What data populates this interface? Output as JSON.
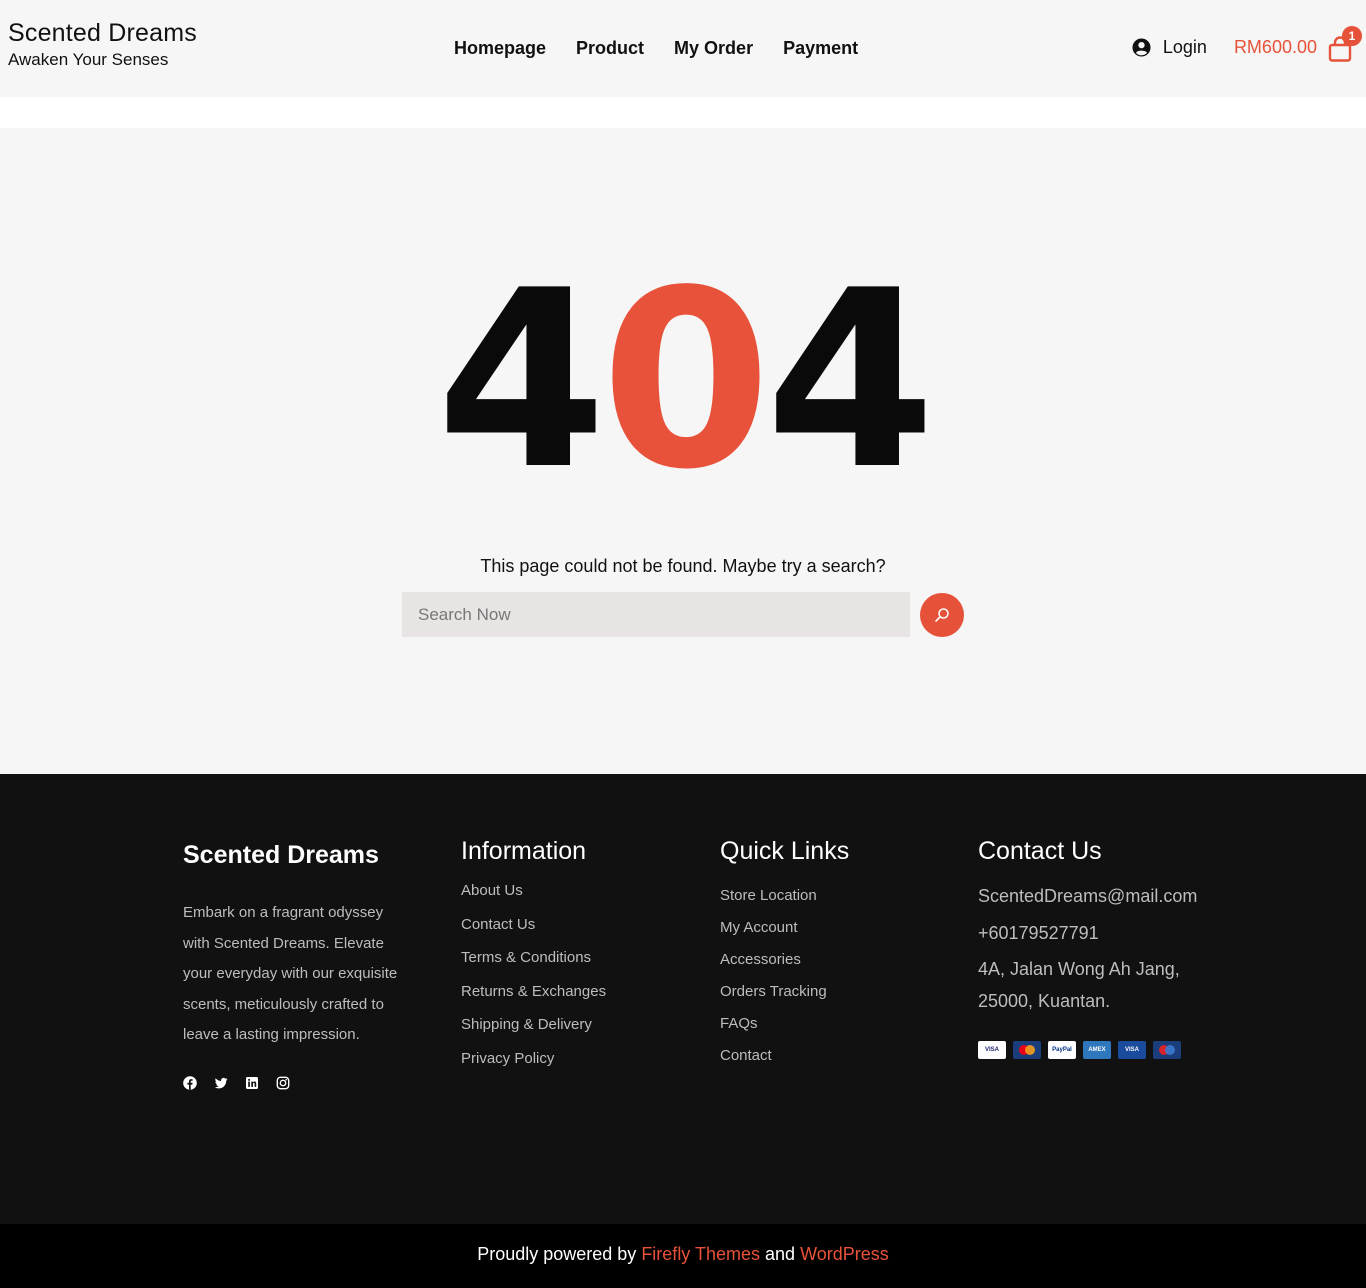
{
  "header": {
    "brand_title": "Scented Dreams",
    "brand_tagline": "Awaken Your Senses",
    "nav": [
      "Homepage",
      "Product",
      "My Order",
      "Payment"
    ],
    "login_label": "Login",
    "cart_total": "RM600.00",
    "cart_count": "1",
    "icons": {
      "login": "user-circle-icon",
      "cart": "shopping-bag-icon"
    }
  },
  "main": {
    "error_code": [
      "4",
      "0",
      "4"
    ],
    "message": "This page could not be found. Maybe try a search?",
    "search_placeholder": "Search Now",
    "search_icon": "search-icon"
  },
  "footer": {
    "brand": {
      "title": "Scented Dreams",
      "description": "Embark on a fragrant odyssey with Scented Dreams. Elevate your everyday with our exquisite scents, meticulously crafted to leave a lasting impression.",
      "socials": [
        "facebook-icon",
        "twitter-icon",
        "linkedin-icon",
        "instagram-icon"
      ]
    },
    "information": {
      "title": "Information",
      "links": [
        "About Us",
        "Contact Us",
        "Terms & Conditions",
        "Returns & Exchanges",
        "Shipping & Delivery",
        "Privacy Policy"
      ]
    },
    "quick_links": {
      "title": "Quick Links",
      "links": [
        "Store Location",
        "My Account",
        "Accessories",
        "Orders Tracking",
        "FAQs",
        "Contact"
      ]
    },
    "contact": {
      "title": "Contact Us",
      "email": "ScentedDreams@mail.com",
      "phone": "+60179527791",
      "address": "4A, Jalan Wong Ah Jang, 25000, Kuantan.",
      "cards": [
        {
          "name": "visa",
          "label": "VISA",
          "bg": "#ffffff",
          "fg": "#1a1f71"
        },
        {
          "name": "mastercard",
          "label": "",
          "bg": "#1a3d7c",
          "fg": "#ffffff"
        },
        {
          "name": "paypal",
          "label": "PayPal",
          "bg": "#ffffff",
          "fg": "#003087"
        },
        {
          "name": "amex",
          "label": "AMEX",
          "bg": "#2e77bc",
          "fg": "#ffffff"
        },
        {
          "name": "visa-electron",
          "label": "VISA",
          "bg": "#1a4b9c",
          "fg": "#ffffff"
        },
        {
          "name": "maestro",
          "label": "",
          "bg": "#1a3d7c",
          "fg": "#ffffff"
        }
      ]
    }
  },
  "bottom": {
    "prefix": "Proudly powered by ",
    "link1": "Firefly Themes",
    "mid": " and ",
    "link2": "WordPress"
  },
  "colors": {
    "accent": "#e65239",
    "footer_bg": "#111111",
    "page_bg": "#f6f6f6"
  }
}
